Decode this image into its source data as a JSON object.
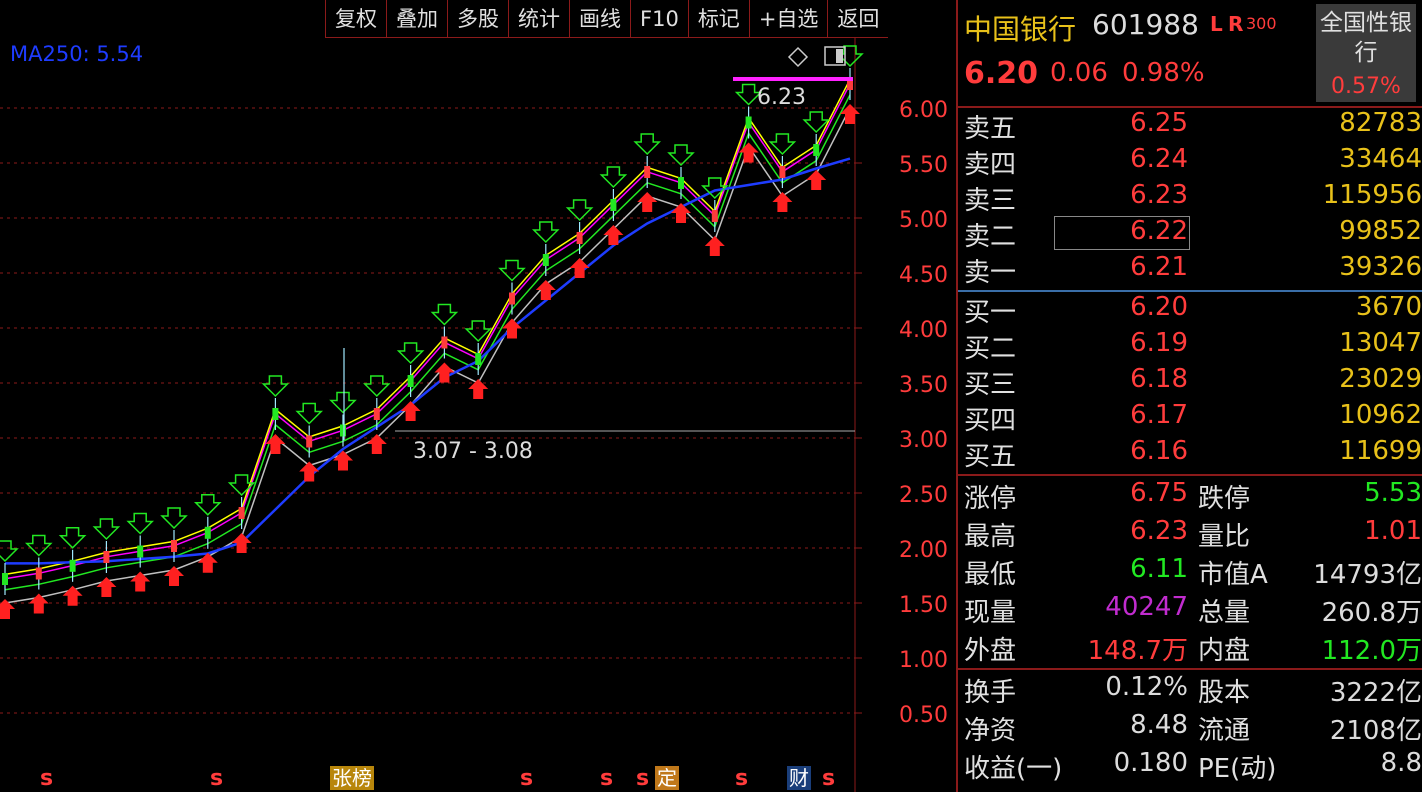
{
  "toolbar": [
    "复权",
    "叠加",
    "多股",
    "统计",
    "画线",
    "F10",
    "标记",
    "+自选",
    "返回"
  ],
  "ma_label": "MA250: 5.54",
  "price_axis": [
    "6.00",
    "5.50",
    "5.00",
    "4.50",
    "4.00",
    "3.50",
    "3.00",
    "2.50",
    "2.00",
    "1.50",
    "1.00",
    "0.50"
  ],
  "annotations": {
    "high_label": "6.23",
    "low_label": "3.07 - 3.08"
  },
  "event_labels": {
    "rank": "张榜",
    "fixed": "定",
    "finance": "财",
    "s": "s"
  },
  "stock": {
    "name": "中国银行",
    "code": "601988",
    "flags": "L",
    "flags2": "R",
    "index_tag": "300",
    "price": "6.20",
    "change": "0.06",
    "change_pct": "0.98%",
    "sector": "全国性银行",
    "sector_change": "0.57%"
  },
  "asks": [
    {
      "label": "卖五",
      "price": "6.25",
      "vol": "82783"
    },
    {
      "label": "卖四",
      "price": "6.24",
      "vol": "33464"
    },
    {
      "label": "卖三",
      "price": "6.23",
      "vol": "115956"
    },
    {
      "label": "卖二",
      "price": "6.22",
      "vol": "99852"
    },
    {
      "label": "卖一",
      "price": "6.21",
      "vol": "39326"
    }
  ],
  "bids": [
    {
      "label": "买一",
      "price": "6.20",
      "vol": "3670"
    },
    {
      "label": "买二",
      "price": "6.19",
      "vol": "13047"
    },
    {
      "label": "买三",
      "price": "6.18",
      "vol": "23029"
    },
    {
      "label": "买四",
      "price": "6.17",
      "vol": "10962"
    },
    {
      "label": "买五",
      "price": "6.16",
      "vol": "11699"
    }
  ],
  "stats1": [
    {
      "l1": "涨停",
      "v1": "6.75",
      "l2": "跌停",
      "v2": "5.53"
    },
    {
      "l1": "最高",
      "v1": "6.23",
      "l2": "量比",
      "v2": "1.01"
    },
    {
      "l1": "最低",
      "v1": "6.11",
      "l2": "市值A",
      "v2": "14793亿"
    },
    {
      "l1": "现量",
      "v1": "40247",
      "l2": "总量",
      "v2": "260.8万"
    },
    {
      "l1": "外盘",
      "v1": "148.7万",
      "l2": "内盘",
      "v2": "112.0万"
    }
  ],
  "stats2": [
    {
      "l1": "换手",
      "v1": "0.12%",
      "l2": "股本",
      "v2": "3222亿"
    },
    {
      "l1": "净资",
      "v1": "8.48",
      "l2": "流通",
      "v2": "2108亿"
    },
    {
      "l1": "收益(一)",
      "v1": "0.180",
      "l2": "PE(动)",
      "v2": "8.8"
    }
  ],
  "colors": {
    "up": "#ff3c3c",
    "down": "#22e822",
    "ma250": "#1e3cff",
    "border": "#8b1a1a",
    "volume": "#e8c11a"
  },
  "chart_data": {
    "type": "line",
    "series": [
      {
        "name": "MA250",
        "values": [
          1.86,
          1.86,
          1.87,
          1.88,
          1.9,
          1.92,
          1.95,
          2.05,
          2.35,
          2.65,
          2.9,
          3.1,
          3.3,
          3.55,
          3.7,
          4.0,
          4.25,
          4.5,
          4.75,
          4.95,
          5.1,
          5.25,
          5.3,
          5.35,
          5.45,
          5.54
        ]
      }
    ],
    "price_close": [
      1.7,
      1.75,
      1.82,
      1.9,
      1.95,
      2.0,
      2.12,
      2.3,
      3.2,
      2.95,
      3.05,
      3.2,
      3.5,
      3.85,
      3.7,
      4.25,
      4.6,
      4.8,
      5.1,
      5.4,
      5.3,
      5.0,
      5.85,
      5.4,
      5.6,
      6.2
    ],
    "ylim": [
      0.25,
      6.3
    ],
    "yticks": [
      6.0,
      5.5,
      5.0,
      4.5,
      4.0,
      3.5,
      3.0,
      2.5,
      2.0,
      1.5,
      1.0,
      0.5
    ]
  }
}
